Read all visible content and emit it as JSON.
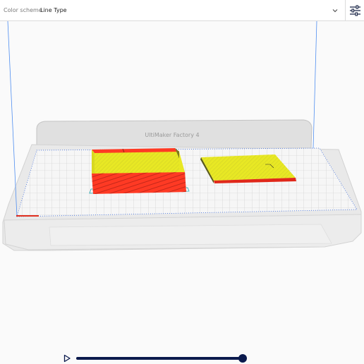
{
  "toolbar": {
    "color_scheme_label": "Color scheme",
    "color_scheme_value": "Line Type",
    "dropdown_icon": "chevron-down-icon",
    "settings_icon": "sliders-icon"
  },
  "viewport": {
    "printer_name": "UltiMaker Factory 4"
  },
  "colors": {
    "accent": "#0b1a4d",
    "skin": "#e8e824",
    "wall": "#ff3a24",
    "build_plate": "#f2f2f2"
  },
  "playback": {
    "play_icon": "play-icon",
    "progress": 1.0
  }
}
